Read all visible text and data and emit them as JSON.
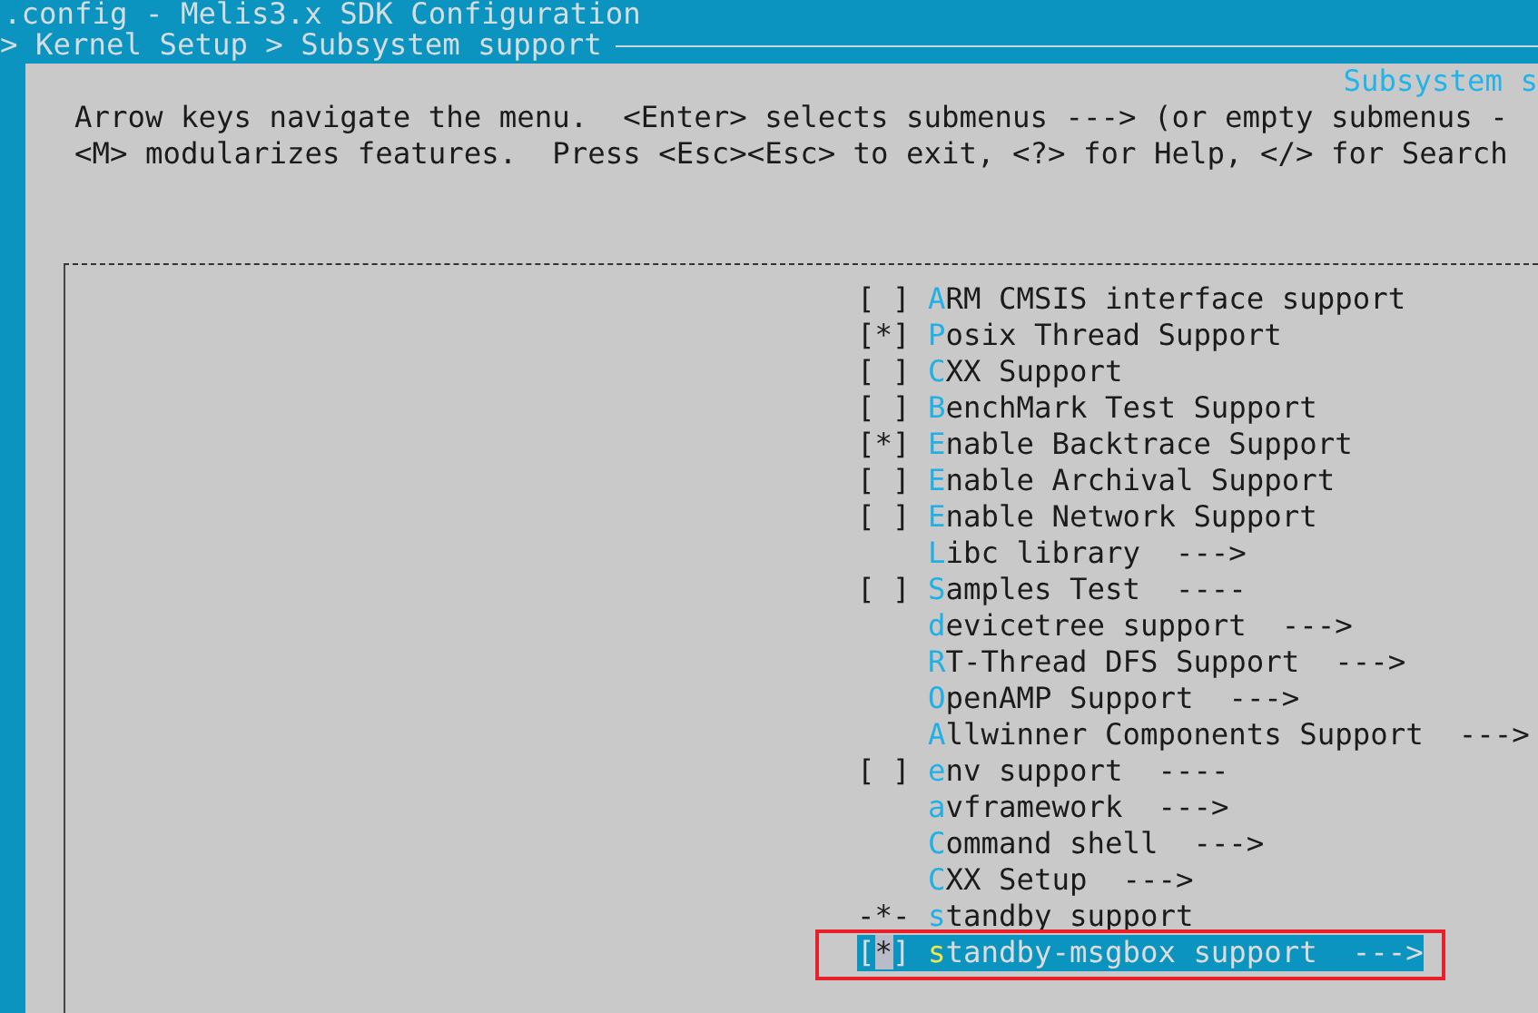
{
  "window": {
    "title": ".config - Melis3.x SDK Configuration"
  },
  "breadcrumb": "> Kernel Setup > Subsystem support",
  "dialog": {
    "title": "Subsystem s",
    "help": [
      "Arrow keys navigate the menu.  <Enter> selects submenus ---> (or empty submenus -",
      "<M> modularizes features.  Press <Esc><Esc> to exit, <?> for Help, </> for Search"
    ],
    "items": [
      {
        "marker": "[ ]",
        "label": "ARM CMSIS interface support",
        "selected": false
      },
      {
        "marker": "[*]",
        "label": "Posix Thread Support",
        "selected": false
      },
      {
        "marker": "[ ]",
        "label": "CXX Support",
        "selected": false
      },
      {
        "marker": "[ ]",
        "label": "BenchMark Test Support",
        "selected": false
      },
      {
        "marker": "[*]",
        "label": "Enable Backtrace Support",
        "selected": false
      },
      {
        "marker": "[ ]",
        "label": "Enable Archival Support",
        "selected": false
      },
      {
        "marker": "[ ]",
        "label": "Enable Network Support",
        "selected": false
      },
      {
        "label": "Libc library",
        "suffix": "--->",
        "selected": false
      },
      {
        "marker": "[ ]",
        "label": "Samples Test",
        "suffix": "----",
        "selected": false
      },
      {
        "label": "devicetree support",
        "suffix": "--->",
        "selected": false
      },
      {
        "label": "RT-Thread DFS Support",
        "suffix": "--->",
        "selected": false
      },
      {
        "label": "OpenAMP Support",
        "suffix": "--->",
        "selected": false
      },
      {
        "label": "Allwinner Components Support",
        "suffix": "--->",
        "selected": false
      },
      {
        "marker": "[ ]",
        "label": "env support",
        "suffix": "----",
        "selected": false
      },
      {
        "label": "avframework",
        "suffix": "--->",
        "selected": false
      },
      {
        "label": "Command shell",
        "suffix": "--->",
        "selected": false
      },
      {
        "label": "CXX Setup",
        "suffix": "--->",
        "selected": false
      },
      {
        "marker": "-*-",
        "label": "standby support",
        "selected": false
      },
      {
        "marker": "[*]",
        "label": "standby-msgbox support",
        "suffix": "--->",
        "selected": true
      }
    ]
  }
}
